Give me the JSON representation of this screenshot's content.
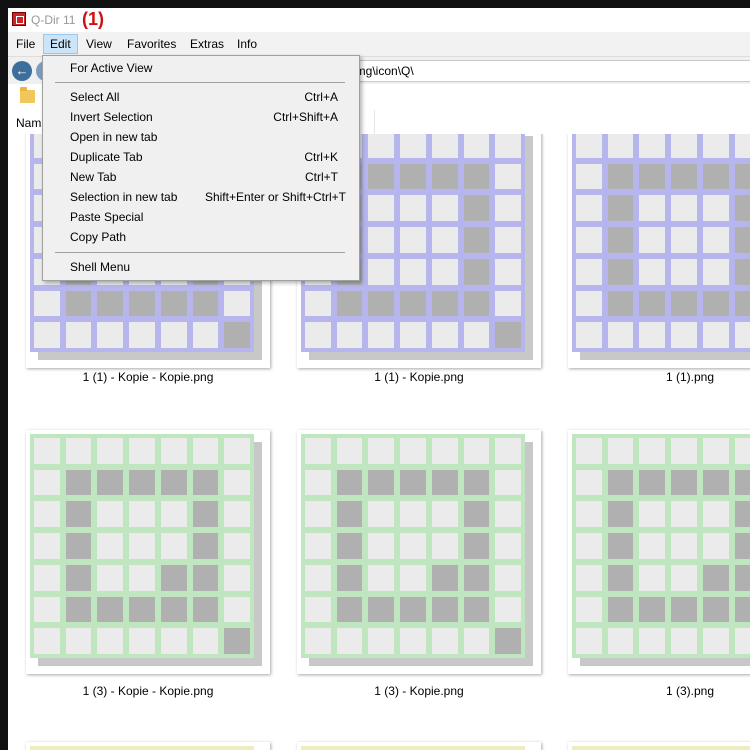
{
  "window": {
    "title": "Q-Dir 11",
    "annotation": "(1)"
  },
  "menubar": {
    "items": [
      {
        "label": "File",
        "active": false
      },
      {
        "label": "Edit",
        "active": true
      },
      {
        "label": "View",
        "active": false
      },
      {
        "label": "Favorites",
        "active": false
      },
      {
        "label": "Extras",
        "active": false
      },
      {
        "label": "Info",
        "active": false
      }
    ]
  },
  "toolbar": {
    "nav_glyph": "←",
    "path": "n\\img\\icon\\Q\\"
  },
  "columns": {
    "name_header": "Nam"
  },
  "edit_menu": {
    "items": [
      {
        "label": "For Active View",
        "shortcut": ""
      },
      {
        "label": "Select All",
        "shortcut": "Ctrl+A"
      },
      {
        "label": "Invert Selection",
        "shortcut": "Ctrl+Shift+A"
      },
      {
        "label": "Open in new tab",
        "shortcut": ""
      },
      {
        "label": "Duplicate Tab",
        "shortcut": "Ctrl+K"
      },
      {
        "label": "New Tab",
        "shortcut": "Ctrl+T"
      },
      {
        "label": "Selection in new tab",
        "shortcut": "Shift+Enter or Shift+Ctrl+T"
      },
      {
        "label": "Paste Special",
        "shortcut": ""
      },
      {
        "label": "Copy Path",
        "shortcut": ""
      },
      {
        "label": "Shell Menu",
        "shortcut": ""
      }
    ]
  },
  "files": [
    {
      "name": "1 (1) - Kopie - Kopie.png",
      "color": "#b6b6ec"
    },
    {
      "name": "1 (1) - Kopie.png",
      "color": "#b6b6ec"
    },
    {
      "name": "1 (1).png",
      "color": "#b6b6ec"
    },
    {
      "name": "1 (3) - Kopie - Kopie.png",
      "color": "#bfe6be"
    },
    {
      "name": "1 (3) - Kopie.png",
      "color": "#bfe6be"
    },
    {
      "name": "1 (3).png",
      "color": "#bfe6be"
    }
  ],
  "icons": {
    "app": "q-dir-app-icon",
    "back": "back-arrow-icon",
    "folder": "folder-icon"
  }
}
